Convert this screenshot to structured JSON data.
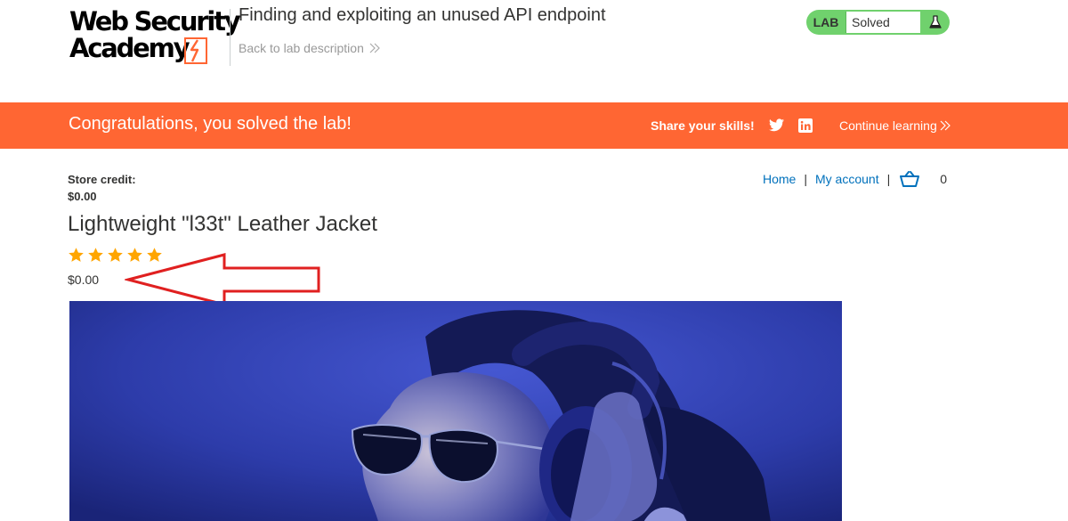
{
  "header": {
    "logo": {
      "line1": "Web Security",
      "line2": "Academy"
    },
    "lab_title": "Finding and exploiting an unused API endpoint",
    "back_link": "Back to lab description",
    "status": {
      "tag": "LAB",
      "value": "Solved",
      "tag_color": "#70d16d"
    }
  },
  "banner": {
    "message": "Congratulations, you solved the lab!",
    "share_label": "Share your skills!",
    "continue_label": "Continue learning",
    "color": "#ff6633"
  },
  "account": {
    "store_credit_label": "Store credit:",
    "store_credit_value": "$0.00"
  },
  "nav": {
    "home": "Home",
    "separator": "|",
    "my_account": "My account",
    "cart_count": "0",
    "link_color": "#0071bc"
  },
  "product": {
    "title": "Lightweight \"l33t\" Leather Jacket",
    "rating": 5,
    "price": "$0.00",
    "star_color": "#ffa500"
  },
  "annotation": {
    "arrow_color": "#e02020"
  }
}
